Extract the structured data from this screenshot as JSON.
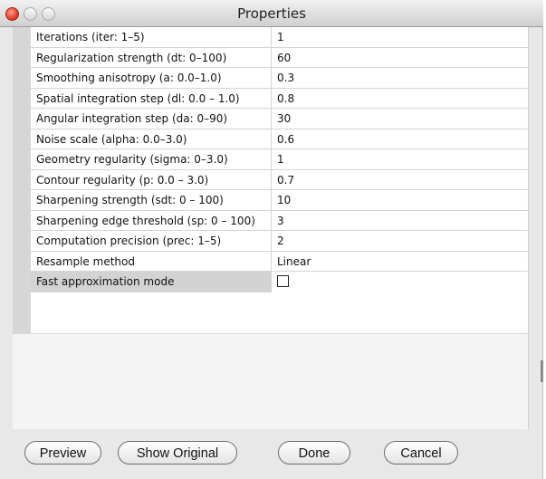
{
  "window": {
    "title": "Properties"
  },
  "properties": [
    {
      "name": "Iterations (iter: 1–5)",
      "value": "1"
    },
    {
      "name": "Regularization strength (dt: 0–100)",
      "value": "60"
    },
    {
      "name": "Smoothing anisotropy (a: 0.0–1.0)",
      "value": "0.3"
    },
    {
      "name": "Spatial integration step (dl: 0.0 – 1.0)",
      "value": "0.8"
    },
    {
      "name": "Angular integration step (da: 0–90)",
      "value": "30"
    },
    {
      "name": "Noise scale (alpha: 0.0–3.0)",
      "value": "0.6"
    },
    {
      "name": "Geometry regularity (sigma: 0–3.0)",
      "value": "1"
    },
    {
      "name": "Contour regularity (p: 0.0 – 3.0)",
      "value": "0.7"
    },
    {
      "name": "Sharpening strength (sdt: 0 – 100)",
      "value": "10"
    },
    {
      "name": "Sharpening edge threshold (sp: 0 – 100)",
      "value": "3"
    },
    {
      "name": "Computation precision (prec: 1–5)",
      "value": "2"
    },
    {
      "name": "Resample method",
      "value": "Linear"
    },
    {
      "name": "Fast approximation mode",
      "checked": false
    }
  ],
  "buttons": {
    "preview": "Preview",
    "show_original": "Show Original",
    "done": "Done",
    "cancel": "Cancel"
  }
}
